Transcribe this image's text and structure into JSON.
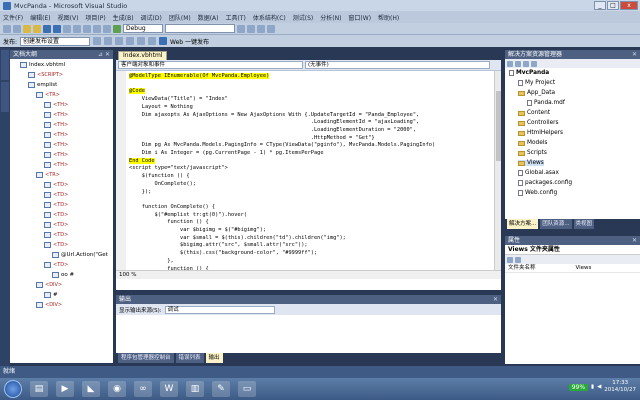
{
  "window": {
    "title": "MvcPanda - Microsoft Visual Studio",
    "controls": [
      "_",
      "□",
      "x"
    ]
  },
  "menu": [
    "文件(F)",
    "编辑(E)",
    "视图(V)",
    "项目(P)",
    "生成(B)",
    "调试(D)",
    "团队(M)",
    "数据(A)",
    "工具(T)",
    "体系结构(C)",
    "测试(S)",
    "分析(N)",
    "窗口(W)",
    "帮助(H)"
  ],
  "toolbar": {
    "config": "Debug"
  },
  "toolbar2": {
    "publish_label": "发布:",
    "publish_combo": "创建发布设置",
    "web_label": "Web 一键发布"
  },
  "outline": {
    "title": "文档大纲",
    "nodes": [
      {
        "label": "Index.vbhtml",
        "kind": "file"
      },
      {
        "label": "<SCRIPT>",
        "kind": "tag"
      },
      {
        "label": "emplist",
        "kind": "item"
      },
      {
        "label": "<TR>",
        "kind": "tag"
      },
      {
        "label": "<TH>",
        "kind": "tag"
      },
      {
        "label": "<TH>",
        "kind": "tag"
      },
      {
        "label": "<TH>",
        "kind": "tag"
      },
      {
        "label": "<TH>",
        "kind": "tag"
      },
      {
        "label": "<TH>",
        "kind": "tag"
      },
      {
        "label": "<TH>",
        "kind": "tag"
      },
      {
        "label": "<TH>",
        "kind": "tag"
      },
      {
        "label": "<TR>",
        "kind": "tag"
      },
      {
        "label": "<TD>",
        "kind": "tag"
      },
      {
        "label": "<TD>",
        "kind": "tag"
      },
      {
        "label": "<TD>",
        "kind": "tag"
      },
      {
        "label": "<TD>",
        "kind": "tag"
      },
      {
        "label": "<TD>",
        "kind": "tag"
      },
      {
        "label": "<TD>",
        "kind": "tag"
      },
      {
        "label": "<TD>",
        "kind": "tag"
      },
      {
        "label": "@Url.Action(\"Get",
        "kind": "item"
      },
      {
        "label": "<TD>",
        "kind": "tag"
      },
      {
        "label": "oo #",
        "kind": "item"
      },
      {
        "label": "<DIV>",
        "kind": "tag"
      },
      {
        "label": "#",
        "kind": "item"
      },
      {
        "label": "<DIV>",
        "kind": "tag"
      }
    ]
  },
  "editor": {
    "tab": "Index.vbhtml",
    "nav_left": "客户端对象和事件",
    "nav_right": "(无事件)",
    "zoom": "100 %",
    "lines": [
      {
        "t": "@ModelType IEnumerable(Of MvcPanda.Employee)",
        "cls": "hl"
      },
      {
        "t": "",
        "cls": ""
      },
      {
        "t": "@Code",
        "cls": "hl"
      },
      {
        "t": "    ViewData(\"Title\") = \"Index\"",
        "cls": ""
      },
      {
        "t": "    Layout = Nothing",
        "cls": ""
      },
      {
        "t": "    Dim ajaxopts As AjaxOptions = New AjaxOptions With {.UpdateTargetId = \"Panda_Employee\",",
        "cls": ""
      },
      {
        "t": "                                                         .LoadingElementId = \"ajaxLoading\",",
        "cls": ""
      },
      {
        "t": "                                                         .LoadingElementDuration = \"2000\",",
        "cls": ""
      },
      {
        "t": "                                                         .HttpMethod = \"Get\"}",
        "cls": ""
      },
      {
        "t": "    Dim pg As MvcPanda.Models.PagingInfo = CType(ViewData(\"pginfo\"), MvcPanda.Models.PagingInfo)",
        "cls": ""
      },
      {
        "t": "    Dim i As Integer = (pg.CurrentPage - 1) * pg.ItemsPerPage",
        "cls": ""
      },
      {
        "t": "End Code",
        "cls": "hl"
      },
      {
        "t": "<script type=\"text/javascript\">",
        "cls": ""
      },
      {
        "t": "    $(function () {",
        "cls": ""
      },
      {
        "t": "        OnComplete();",
        "cls": ""
      },
      {
        "t": "    });",
        "cls": ""
      },
      {
        "t": "",
        "cls": ""
      },
      {
        "t": "    function OnComplete() {",
        "cls": ""
      },
      {
        "t": "        $(\"#emplist tr:gt(0)\").hover(",
        "cls": ""
      },
      {
        "t": "            function () {",
        "cls": ""
      },
      {
        "t": "                var $bigimg = $(\"#bigimg\");",
        "cls": ""
      },
      {
        "t": "                var $small = $(this).children(\"td\").children(\"img\");",
        "cls": ""
      },
      {
        "t": "                $bigimg.attr(\"src\", $small.attr(\"src\"));",
        "cls": ""
      },
      {
        "t": "                $(this).css(\"background-color\", \"#9999ff\");",
        "cls": ""
      },
      {
        "t": "            },",
        "cls": ""
      },
      {
        "t": "            function () {",
        "cls": ""
      }
    ]
  },
  "output": {
    "title": "输出",
    "source_label": "显示输出来源(S):",
    "source_value": "调试"
  },
  "bottom_tabs": [
    "程序包管理器控制台",
    "错误列表",
    "输出"
  ],
  "solution": {
    "title": "解决方案资源管理器",
    "nodes": [
      {
        "label": "MvcPanda",
        "kind": "proj",
        "bold": true
      },
      {
        "label": "My Project",
        "kind": "file"
      },
      {
        "label": "App_Data",
        "kind": "fold"
      },
      {
        "label": "Panda.mdf",
        "kind": "file"
      },
      {
        "label": "Content",
        "kind": "fold"
      },
      {
        "label": "Controllers",
        "kind": "fold"
      },
      {
        "label": "HtmlHelpers",
        "kind": "fold"
      },
      {
        "label": "Models",
        "kind": "fold"
      },
      {
        "label": "Scripts",
        "kind": "fold"
      },
      {
        "label": "Views",
        "kind": "fold"
      },
      {
        "label": "Global.asax",
        "kind": "file"
      },
      {
        "label": "packages.config",
        "kind": "file"
      },
      {
        "label": "Web.config",
        "kind": "file"
      }
    ],
    "tabs": [
      "解决方案...",
      "团队资源...",
      "类视图"
    ]
  },
  "properties": {
    "title": "属性",
    "selected": "Views 文件夹属性",
    "rows": [
      {
        "k": "文件夹名称",
        "v": "Views"
      }
    ]
  },
  "statusbar": "就绪",
  "taskbar": {
    "battery": "99%",
    "time": "17:33",
    "date": "2014/10/27"
  }
}
